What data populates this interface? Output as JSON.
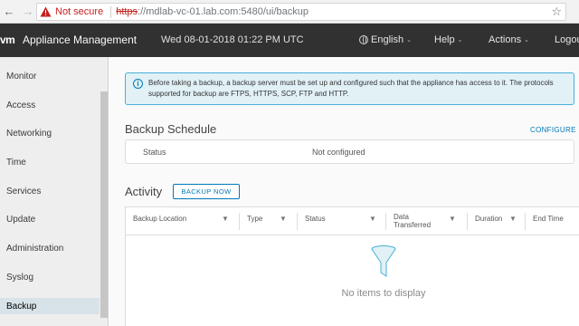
{
  "browser": {
    "security_label": "Not secure",
    "url_scheme": "https",
    "url_rest": "://mdlab-vc-01.lab.com:5480/ui/backup"
  },
  "header": {
    "logo": "vm",
    "title": "Appliance Management",
    "datetime": "Wed 08-01-2018 01:22 PM UTC",
    "menus": {
      "language": "English",
      "help": "Help",
      "actions": "Actions",
      "logout": "Logou"
    }
  },
  "sidebar": {
    "items": [
      {
        "label": "Monitor"
      },
      {
        "label": "Access"
      },
      {
        "label": "Networking"
      },
      {
        "label": "Time"
      },
      {
        "label": "Services"
      },
      {
        "label": "Update"
      },
      {
        "label": "Administration"
      },
      {
        "label": "Syslog"
      },
      {
        "label": "Backup",
        "active": true
      }
    ]
  },
  "info": {
    "text": "Before taking a backup, a backup server must be set up and configured such that the appliance has access to it. The protocols supported for backup are FTPS, HTTPS, SCP, FTP and HTTP."
  },
  "schedule": {
    "title": "Backup Schedule",
    "configure_label": "CONFIGURE",
    "status_label": "Status",
    "status_value": "Not configured"
  },
  "activity": {
    "title": "Activity",
    "backup_now_label": "BACKUP NOW",
    "columns": [
      {
        "label": "Backup Location"
      },
      {
        "label": "Type"
      },
      {
        "label": "Status"
      },
      {
        "label": "Data Transferred"
      },
      {
        "label": "Duration"
      },
      {
        "label": "End Time"
      }
    ],
    "empty_text": "No items to display"
  },
  "colors": {
    "header_bg": "#313131",
    "accent": "#0079b8",
    "info_bg": "#e1f1f6",
    "sidebar_bg": "#eeeeee",
    "active_item_bg": "#d8e3e9"
  },
  "icons": {
    "back": "arrow-left-icon",
    "forward": "arrow-right-icon",
    "reload": "reload-icon",
    "warning": "warning-triangle-icon",
    "bookmark": "star-icon",
    "language": "globe-icon",
    "info": "info-icon",
    "filter": "filter-icon",
    "empty": "funnel-icon"
  }
}
